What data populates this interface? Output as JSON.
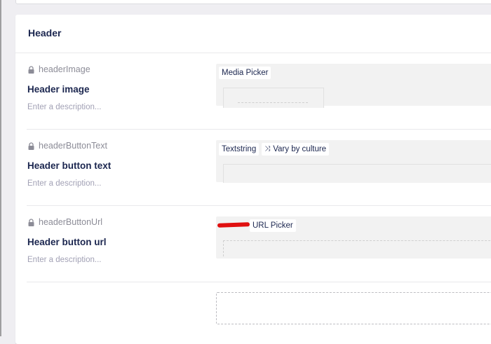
{
  "group": {
    "title": "Header",
    "properties": [
      {
        "alias": "headerImage",
        "label": "Header image",
        "description": "Enter a description...",
        "editor_tags": [
          "Media Picker"
        ]
      },
      {
        "alias": "headerButtonText",
        "label": "Header button text",
        "description": "Enter a description...",
        "editor_tags": [
          "Textstring",
          "Vary by culture"
        ]
      },
      {
        "alias": "headerButtonUrl",
        "label": "Header button url",
        "description": "Enter a description...",
        "editor_tags": [
          "[Redacted]",
          "URL Picker"
        ]
      }
    ]
  },
  "icons": {
    "lock": "lock-icon",
    "vary": "shuffle-icon"
  },
  "colors": {
    "text_dark": "#1b264f",
    "alias_gray": "#8c8c97",
    "description": "#a2a1b5",
    "editor_bg": "#f2f2f2",
    "redaction": "#e01010"
  }
}
